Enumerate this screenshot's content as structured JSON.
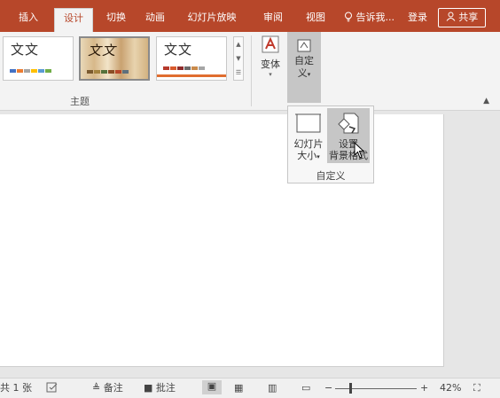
{
  "tabs": [
    {
      "label": "插入",
      "active": false
    },
    {
      "label": "设计",
      "active": true
    },
    {
      "label": "切换",
      "active": false
    },
    {
      "label": "动画",
      "active": false
    },
    {
      "label": "幻灯片放映",
      "active": false
    },
    {
      "label": "审阅",
      "active": false
    },
    {
      "label": "视图",
      "active": false
    }
  ],
  "tell_me": "告诉我...",
  "login": "登录",
  "share": "共享",
  "themes": {
    "items": [
      {
        "text": "文文"
      },
      {
        "text": "文文"
      },
      {
        "text": "文文"
      }
    ],
    "group_label": "主题"
  },
  "variant": {
    "label": "变体"
  },
  "customize": {
    "label_line1": "自定",
    "label_line2": "义"
  },
  "popup": {
    "slide_size_line1": "幻灯片",
    "slide_size_line2": "大小",
    "format_bg_line1": "设置",
    "format_bg_line2": "背景格式",
    "group_label": "自定义"
  },
  "statusbar": {
    "slide_count": "共 1 张",
    "notes": "备注",
    "comments": "批注",
    "zoom": "42%"
  },
  "colors": {
    "accent": "#b7472a",
    "ribbon_bg": "#f3f3f3",
    "hover": "#c6c6c6"
  }
}
